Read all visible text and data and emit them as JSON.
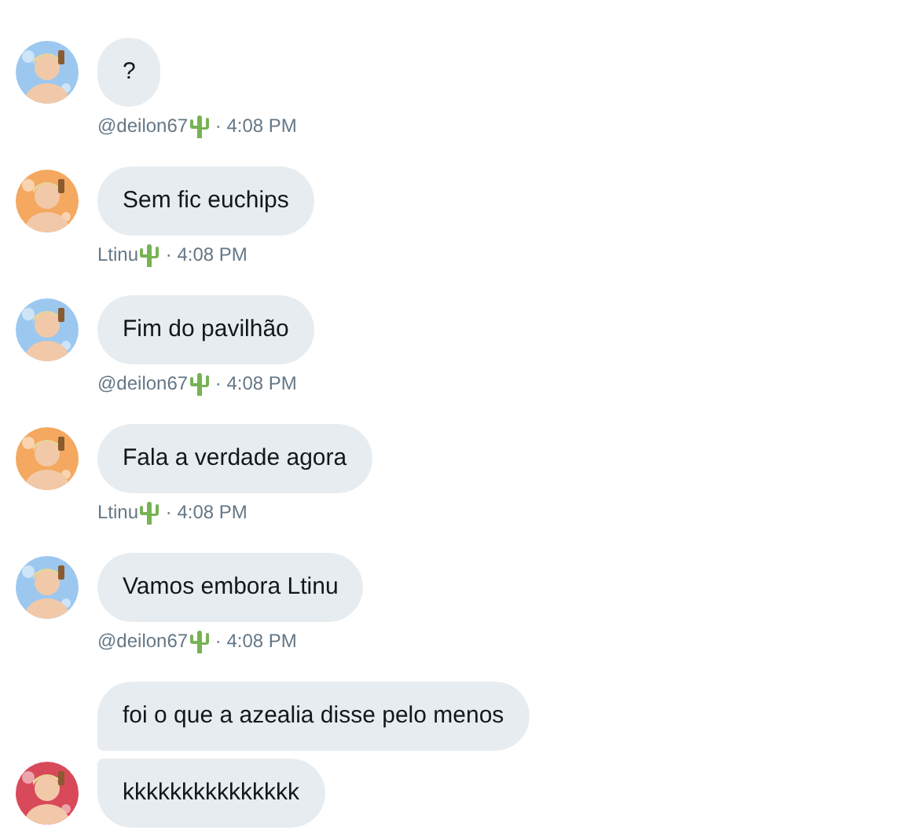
{
  "messages": [
    {
      "author": "@deilon67",
      "time": "· 4:08 PM",
      "avatar": {
        "kind": "picture"
      },
      "bubbles": [
        "?"
      ]
    },
    {
      "author": "Ltinu",
      "time": "· 4:08 PM",
      "avatar": {
        "kind": "picture"
      },
      "bubbles": [
        "Sem fic euchips"
      ]
    },
    {
      "author": "@deilon67",
      "time": "· 4:08 PM",
      "avatar": {
        "kind": "picture"
      },
      "bubbles": [
        "Fim do pavilhão"
      ]
    },
    {
      "author": "Ltinu",
      "time": "· 4:08 PM",
      "avatar": {
        "kind": "picture"
      },
      "bubbles": [
        "Fala a verdade agora"
      ]
    },
    {
      "author": "@deilon67",
      "time": "· 4:08 PM",
      "avatar": {
        "kind": "picture"
      },
      "bubbles": [
        "Vamos embora Ltinu"
      ]
    },
    {
      "avatar": {
        "kind": "picture"
      },
      "bubbles": [
        "foi o que a azealia disse pelo menos",
        "kkkkkkkkkkkkkkk"
      ]
    }
  ]
}
